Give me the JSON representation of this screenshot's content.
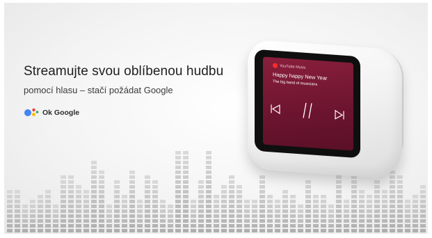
{
  "banner": {
    "headline": "Streamujte svou oblíbenou hudbu",
    "subline": "pomocí hlasu – stačí požádat Google",
    "ok_google": "Ok Google",
    "icons": [
      "google-assistant-icon",
      "youtube-music-icon",
      "previous-track-icon",
      "pause-icon",
      "next-track-icon"
    ]
  },
  "device_screen": {
    "app_name": "YouTube Music",
    "song_title": "Happy happy New Year",
    "song_artist": "The big band of musicians"
  },
  "colors": {
    "background": "#f4f4f4",
    "screen": "#7a1a36",
    "bars": "#c9c9c9",
    "assistant_blue": "#4285f4",
    "assistant_red": "#ea4335",
    "assistant_yellow": "#fbbc05",
    "assistant_green": "#34a853"
  }
}
